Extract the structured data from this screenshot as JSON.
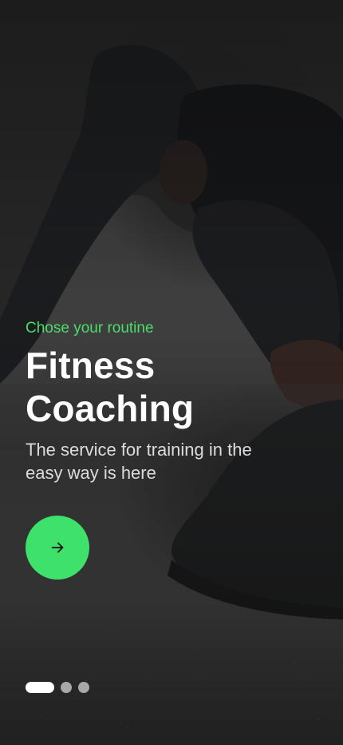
{
  "onboarding": {
    "eyebrow": "Chose your routine",
    "title_line1": "Fitness",
    "title_line2": "Coaching",
    "subtitle_line1": "The service for training in the",
    "subtitle_line2": "easy way is here"
  },
  "next_button": {
    "icon": "arrow-right-icon",
    "color": "#3ee26a"
  },
  "pager": {
    "total": 3,
    "current": 1
  },
  "colors": {
    "accent": "#3ee26a",
    "eyebrow": "#4ade6b",
    "title": "#ffffff",
    "subtitle": "#dcdcdc"
  }
}
